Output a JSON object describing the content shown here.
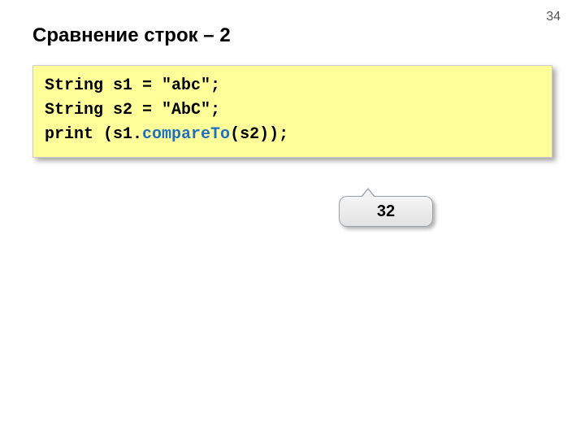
{
  "page_number": "34",
  "title": "Сравнение строк – 2",
  "code": {
    "line1a": "String s1 = ",
    "line1b": "\"abc\"",
    "line1c": ";",
    "line2a": "String s2 = ",
    "line2b": "\"AbC\"",
    "line2c": ";",
    "line3a": "print (s1.",
    "line3b": "compareTo",
    "line3c": "(s2));"
  },
  "callout_value": "32"
}
